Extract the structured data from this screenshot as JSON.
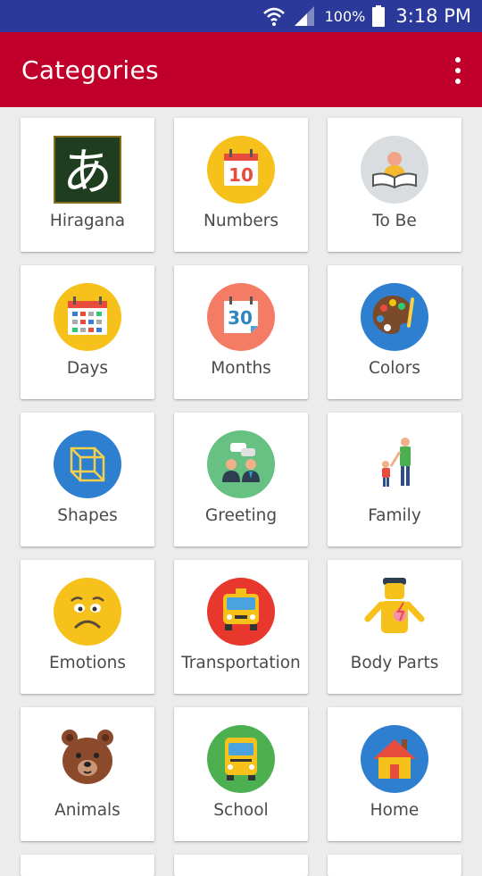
{
  "status_bar": {
    "battery_text": "100%",
    "time": "3:18 PM",
    "icons": [
      "wifi-icon",
      "signal-icon",
      "battery-icon"
    ]
  },
  "app_bar": {
    "title": "Categories",
    "menu_icon": "overflow-menu-icon"
  },
  "colors": {
    "status_bar": "#2b3a9a",
    "app_bar": "#c0002b",
    "background": "#ececec"
  },
  "categories": [
    {
      "label": "Hiragana",
      "icon": "hiragana-icon",
      "glyph": "あ"
    },
    {
      "label": "Numbers",
      "icon": "calendar-10-icon",
      "number": "10"
    },
    {
      "label": "To Be",
      "icon": "reader-icon"
    },
    {
      "label": "Days",
      "icon": "calendar-grid-icon"
    },
    {
      "label": "Months",
      "icon": "calendar-30-icon",
      "number": "30"
    },
    {
      "label": "Colors",
      "icon": "palette-icon"
    },
    {
      "label": "Shapes",
      "icon": "cube-icon"
    },
    {
      "label": "Greeting",
      "icon": "people-chat-icon"
    },
    {
      "label": "Family",
      "icon": "family-icon"
    },
    {
      "label": "Emotions",
      "icon": "sad-face-icon"
    },
    {
      "label": "Transportation",
      "icon": "taxi-icon"
    },
    {
      "label": "Body Parts",
      "icon": "body-icon"
    },
    {
      "label": "Animals",
      "icon": "bear-icon"
    },
    {
      "label": "School",
      "icon": "school-bus-icon"
    },
    {
      "label": "Home",
      "icon": "house-icon"
    }
  ]
}
